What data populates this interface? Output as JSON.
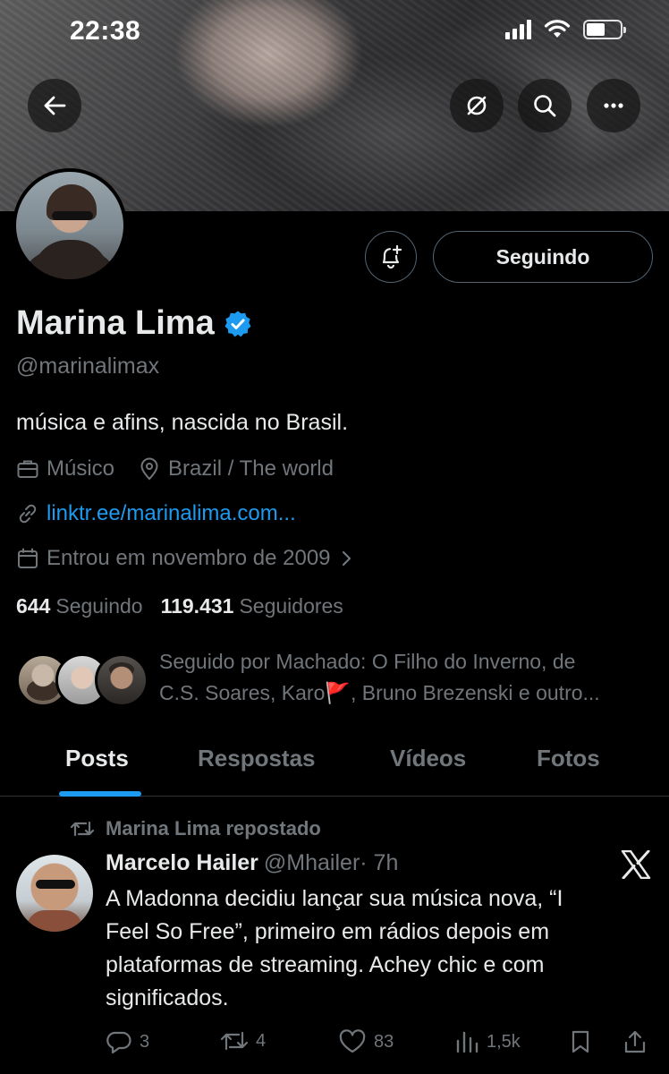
{
  "status_bar": {
    "time": "22:38"
  },
  "header": {
    "back_icon": "arrow-left-icon",
    "icons": [
      "eye-slash-icon",
      "search-icon",
      "more-icon"
    ]
  },
  "profile": {
    "display_name": "Marina Lima",
    "verified": true,
    "handle": "@marinalimax",
    "bio": "música e afins, nascida no Brasil.",
    "category": "Músico",
    "location": "Brazil / The world",
    "link": "linktr.ee/marinalima.com...",
    "joined": "Entrou em novembro de 2009",
    "following_count": "644",
    "following_label": "Seguindo",
    "followers_count": "119.431",
    "followers_label": "Seguidores",
    "follow_button_label": "Seguindo",
    "followed_by_line1": "Seguido por Machado: O Filho do Inverno, de",
    "followed_by_line2a": "C.S. Soares, Karo",
    "followed_by_flag": "🚩",
    "followed_by_line2b": ", Bruno Brezenski e outro..."
  },
  "tabs": [
    {
      "label": "Posts",
      "active": true
    },
    {
      "label": "Respostas",
      "active": false
    },
    {
      "label": "Vídeos",
      "active": false
    },
    {
      "label": "Fotos",
      "active": false
    }
  ],
  "post": {
    "repost_label": "Marina Lima repostado",
    "author": "Marcelo Hailer",
    "handle": "@Mhailer",
    "time": "· 7h",
    "text_line1": "A Madonna decidiu lançar sua música nova, “I",
    "text_line2": "Feel So Free”, primeiro em rádios depois em",
    "text_line3": "plataformas de streaming. Achey chic e com",
    "text_line4": "significados.",
    "replies": "3",
    "reposts": "4",
    "likes": "83",
    "views": "1,5k"
  },
  "colors": {
    "accent": "#1d9bf0",
    "muted": "#71767b",
    "text": "#e7e9ea",
    "background": "#000000"
  }
}
